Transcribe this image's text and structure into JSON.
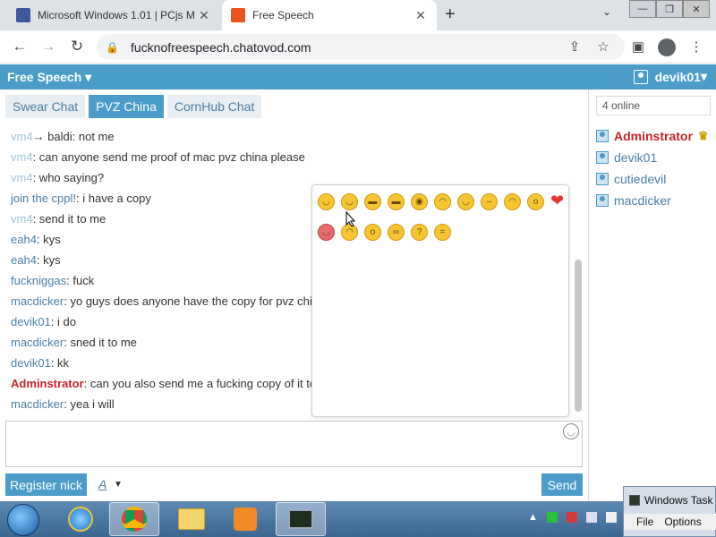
{
  "browser": {
    "tabs": [
      {
        "title": "Microsoft Windows 1.01 | PCjs M",
        "icon": "pcjs-icon",
        "active": false
      },
      {
        "title": "Free Speech",
        "icon": "chatovod-icon",
        "active": true
      }
    ],
    "new_tab": "+",
    "url": "fucknofreespeech.chatovod.com"
  },
  "app": {
    "room_title": "Free Speech",
    "username": "devik01",
    "chat_tabs": [
      {
        "label": "Swear Chat",
        "active": false
      },
      {
        "label": "PVZ China",
        "active": true
      },
      {
        "label": "CornHub Chat",
        "active": false
      }
    ]
  },
  "messages": [
    {
      "nick": "vm4",
      "to": "→ baldi",
      "sep": ":",
      "text": " not me",
      "style": "faded"
    },
    {
      "nick": "vm4",
      "sep": ":",
      "text": " can anyone send me proof of mac pvz china please",
      "style": "faded"
    },
    {
      "nick": "vm4",
      "sep": ":",
      "text": " who saying?",
      "style": "faded"
    },
    {
      "nick": "join the cppl!",
      "sep": ":",
      "text": " i have a copy",
      "style": "normal"
    },
    {
      "nick": "vm4",
      "sep": ":",
      "text": " send it to me",
      "style": "faded"
    },
    {
      "nick": "eah4",
      "sep": ":",
      "text": " kys",
      "style": "normal"
    },
    {
      "nick": "eah4",
      "sep": ":",
      "text": " kys",
      "style": "normal"
    },
    {
      "nick": "fuckniggas",
      "sep": ":",
      "text": " fuck",
      "style": "normal"
    },
    {
      "nick": "macdicker",
      "sep": ":",
      "text": " yo guys does anyone have the copy for pvz chi",
      "style": "normal"
    },
    {
      "nick": "devik01",
      "sep": ":",
      "text": " i do",
      "style": "normal"
    },
    {
      "nick": "macdicker",
      "sep": ":",
      "text": " sned it to me",
      "style": "normal"
    },
    {
      "nick": "devik01",
      "sep": ":",
      "text": " kk",
      "style": "normal"
    },
    {
      "nick": "Adminstrator",
      "sep": ":",
      "text": " can you also send me a fucking copy of it to",
      "style": "admin"
    },
    {
      "nick": "macdicker",
      "sep": ":",
      "text": " yea i will",
      "style": "normal"
    }
  ],
  "emoji_panel": {
    "row1": [
      "smile-emoji",
      "grin-emoji",
      "laugh-emoji",
      "big-grin-emoji",
      "shocked-emoji",
      "wink-emoji",
      "tongue-emoji",
      "neutral-emoji",
      "sad-emoji",
      "surprised-emoji",
      "heart-emoji"
    ],
    "row2": [
      "love-emoji",
      "thinking-emoji",
      "whistle-emoji",
      "glasses-emoji",
      "confused-emoji",
      "blush-emoji"
    ]
  },
  "compose": {
    "register_label": "Register nick",
    "font_label": "A",
    "send_label": "Send"
  },
  "sidebar": {
    "online_count": "4 online",
    "users": [
      {
        "name": "Adminstrator",
        "role": "admin"
      },
      {
        "name": "devik01",
        "role": "user"
      },
      {
        "name": "cutiedevil",
        "role": "user"
      },
      {
        "name": "macdicker",
        "role": "user"
      }
    ]
  },
  "taskmgr": {
    "title": "Windows Task",
    "menu": [
      "File",
      "Options"
    ]
  }
}
